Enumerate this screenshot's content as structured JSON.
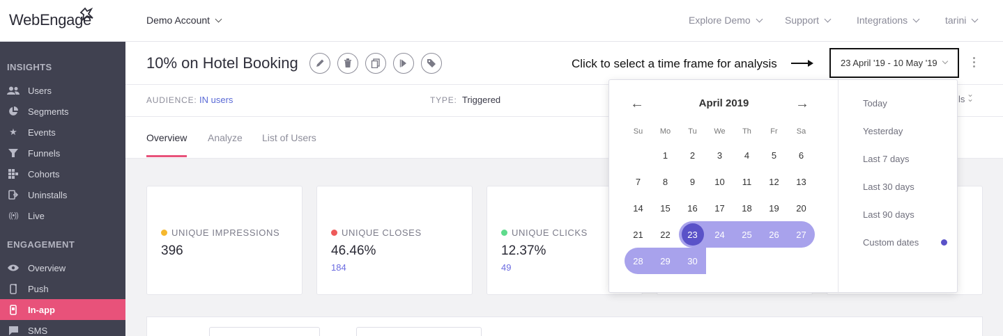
{
  "brand": {
    "logo": "WebEngage"
  },
  "topbar": {
    "account": "Demo Account",
    "nav": [
      "Explore Demo",
      "Support",
      "Integrations",
      "tarini"
    ]
  },
  "sidebar": {
    "insights_title": "INSIGHTS",
    "insights": [
      {
        "label": "Users",
        "icon": "users-icon"
      },
      {
        "label": "Segments",
        "icon": "pie-icon"
      },
      {
        "label": "Events",
        "icon": "star-icon"
      },
      {
        "label": "Funnels",
        "icon": "funnel-icon"
      },
      {
        "label": "Cohorts",
        "icon": "grid-icon"
      },
      {
        "label": "Uninstalls",
        "icon": "uninstall-icon"
      },
      {
        "label": "Live",
        "icon": "broadcast-icon"
      }
    ],
    "engagement_title": "ENGAGEMENT",
    "engagement": [
      {
        "label": "Overview",
        "icon": "eye-icon"
      },
      {
        "label": "Push",
        "icon": "phone-icon"
      },
      {
        "label": "In-app",
        "icon": "inapp-icon",
        "active": true
      },
      {
        "label": "SMS",
        "icon": "chat-icon"
      }
    ]
  },
  "campaign": {
    "title": "10% on Hotel Booking",
    "actions": [
      "edit-icon",
      "delete-icon",
      "copy-icon",
      "play-icon",
      "tag-icon"
    ]
  },
  "hint": "Click to select a time frame for analysis",
  "date_range": "23 April '19 - 10 May '19",
  "meta": {
    "audience_label": "AUDIENCE:",
    "audience_value": "IN users",
    "type_label": "TYPE:",
    "type_value": "Triggered",
    "details_fragment": "ls"
  },
  "tabs": [
    "Overview",
    "Analyze",
    "List of Users"
  ],
  "stats": [
    {
      "label": "UNIQUE IMPRESSIONS",
      "value": "396",
      "sub": "",
      "color": "#f5b82e"
    },
    {
      "label": "UNIQUE CLOSES",
      "value": "46.46%",
      "sub": "184",
      "color": "#ee5a5a"
    },
    {
      "label": "UNIQUE CLICKS",
      "value": "12.37%",
      "sub": "49",
      "color": "#5fdb8c"
    }
  ],
  "calendar": {
    "month": "April 2019",
    "prev": "←",
    "next": "→",
    "weekdays": [
      "Su",
      "Mo",
      "Tu",
      "We",
      "Th",
      "Fr",
      "Sa"
    ],
    "rows": [
      [
        "",
        "1",
        "2",
        "3",
        "4",
        "5",
        "6"
      ],
      [
        "7",
        "8",
        "9",
        "10",
        "11",
        "12",
        "13"
      ],
      [
        "14",
        "15",
        "16",
        "17",
        "18",
        "19",
        "20"
      ],
      [
        "21",
        "22",
        "23",
        "24",
        "25",
        "26",
        "27"
      ],
      [
        "28",
        "29",
        "30",
        "",
        "",
        "",
        ""
      ]
    ],
    "selected_day": "23"
  },
  "presets": [
    "Today",
    "Yesterday",
    "Last 7 days",
    "Last 30 days",
    "Last 90 days",
    "Custom dates"
  ],
  "colors": {
    "accent": "#e8527a",
    "sidebar": "#404150",
    "range": "#a8a2ec",
    "range_start": "#5a52c8"
  }
}
